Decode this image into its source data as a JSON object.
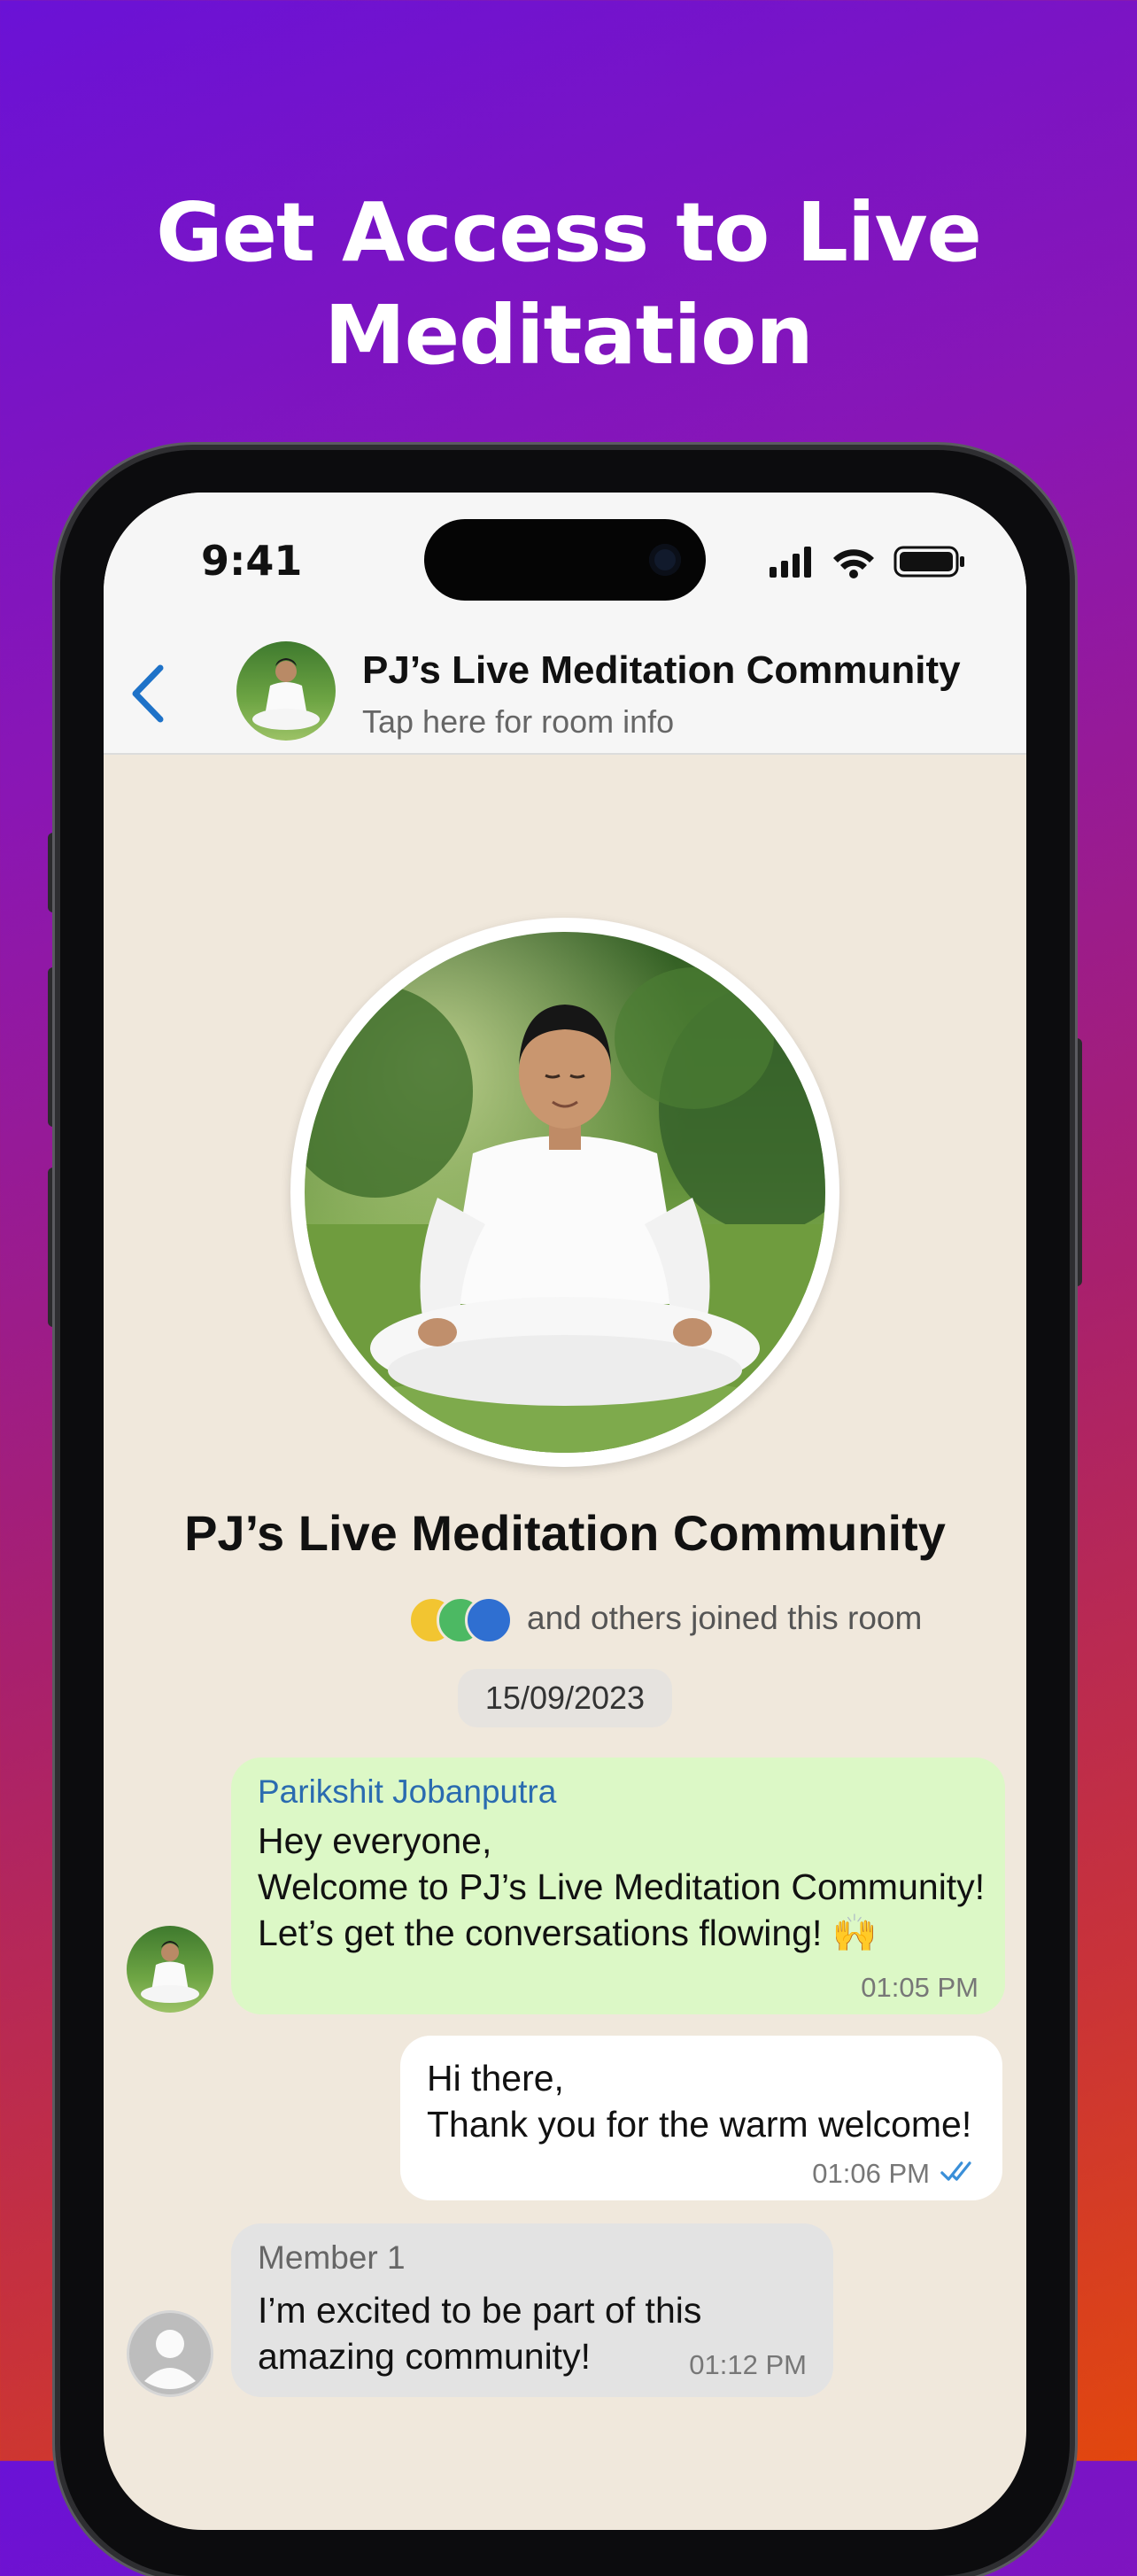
{
  "headline": {
    "line1": "Get Access to Live",
    "line2": "Meditation"
  },
  "status_bar": {
    "time": "9:41",
    "icons": [
      "signal-icon",
      "wifi-icon",
      "battery-icon"
    ]
  },
  "header": {
    "back_icon": "chevron-left-icon",
    "title": "PJ’s Live Meditation Community",
    "subtitle": "Tap here for room info"
  },
  "room": {
    "name": "PJ’s Live Meditation Community",
    "joined_text": "and others joined this room",
    "joined_dot_colors": [
      "#f2c531",
      "#4cb963",
      "#2f6fd1"
    ]
  },
  "date_chip": "15/09/2023",
  "messages": [
    {
      "sender": "Parikshit Jobanputra",
      "sender_color": "#2a6bb0",
      "lines": [
        "Hey everyone,",
        "Welcome to PJ’s Live Meditation Community!",
        "Let’s get the conversations flowing! 🙌"
      ],
      "time": "01:05 PM",
      "bubble_color": "#dcf8c6"
    },
    {
      "lines": [
        "Hi there,",
        "Thank you for the warm welcome!"
      ],
      "time": "01:06 PM",
      "read_icon": "double-check-icon",
      "bubble_color": "#ffffff"
    },
    {
      "sender": "Member 1",
      "lines": [
        "I’m excited to be part of this",
        "amazing community!"
      ],
      "time": "01:12 PM",
      "bubble_color": "#e3e3e3"
    }
  ],
  "colors": {
    "accent_blue": "#1e72c8",
    "chat_background": "#f0e8dc"
  }
}
